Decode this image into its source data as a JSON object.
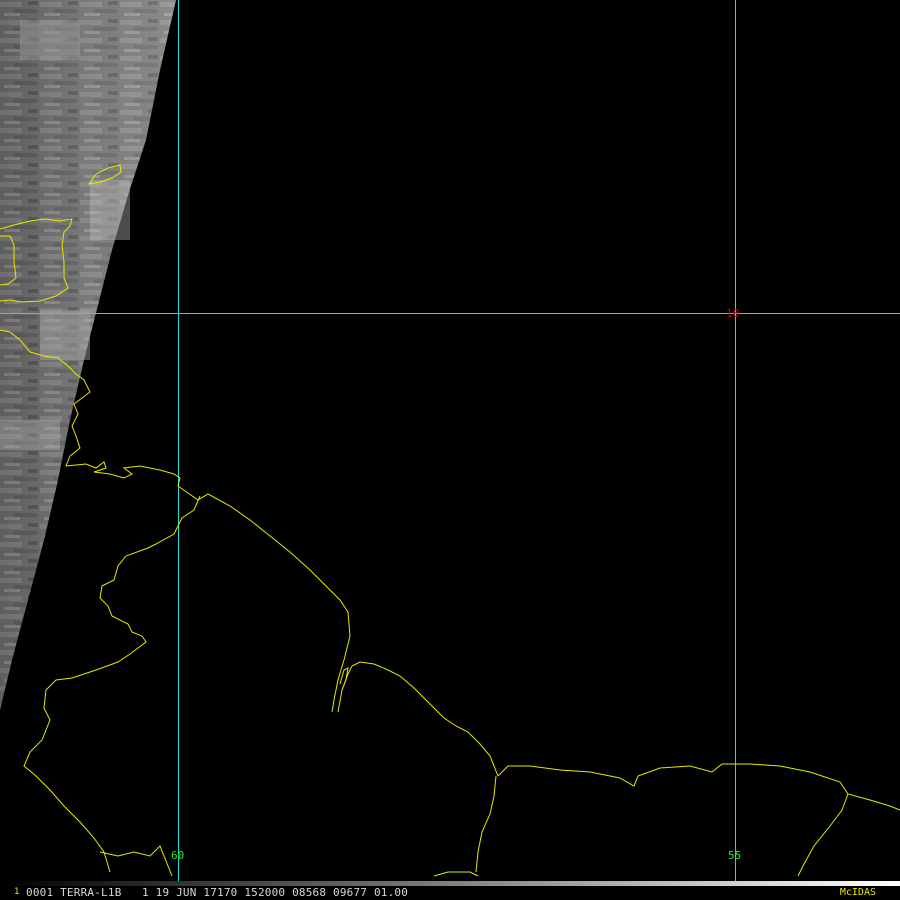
{
  "imagery": {
    "satellite": "TERRA-L1B"
  },
  "grid_labels": {
    "lon_60": "60",
    "lon_55": "55",
    "lat_10": "10"
  },
  "colors": {
    "background": "#000000",
    "grid_lines": "#22d8d8",
    "coastline": "#e8e800",
    "lon_label": "#22e822",
    "lat_label": "#d80000"
  },
  "status_bar": {
    "frame_number": "1",
    "info": "0001 TERRA-L1B   1 19 JUN 17170 152000 08568 09677 01.00",
    "logo": "McIDAS"
  }
}
